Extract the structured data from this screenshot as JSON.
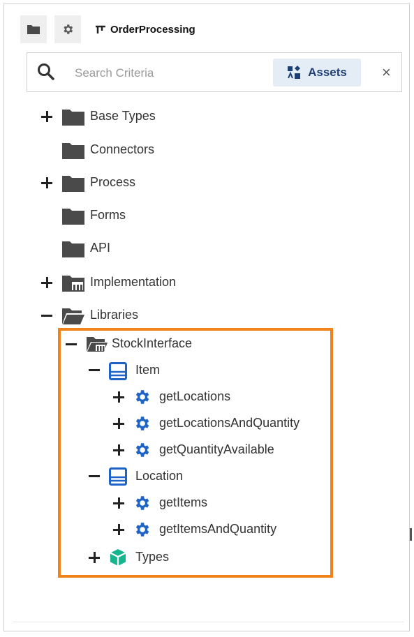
{
  "toolbar": {
    "project_label": "OrderProcessing"
  },
  "search": {
    "placeholder": "Search Criteria",
    "value": "",
    "assets_label": "Assets",
    "close_symbol": "×"
  },
  "tree": {
    "base_types": "Base Types",
    "connectors": "Connectors",
    "process": "Process",
    "forms": "Forms",
    "api": "API",
    "implementation": "Implementation",
    "libraries": "Libraries",
    "stock_interface": "StockInterface",
    "item": "Item",
    "get_locations": "getLocations",
    "get_locations_and_quantity": "getLocationsAndQuantity",
    "get_quantity_available": "getQuantityAvailable",
    "location": "Location",
    "get_items": "getItems",
    "get_items_and_quantity": "getItemsAndQuantity",
    "types": "Types"
  },
  "colors": {
    "highlight": "#f08319",
    "gear_blue": "#1f63c6",
    "types_green": "#16b58e",
    "assets_bg": "#e4ecf5",
    "folder_gray": "#4a4a4a"
  }
}
